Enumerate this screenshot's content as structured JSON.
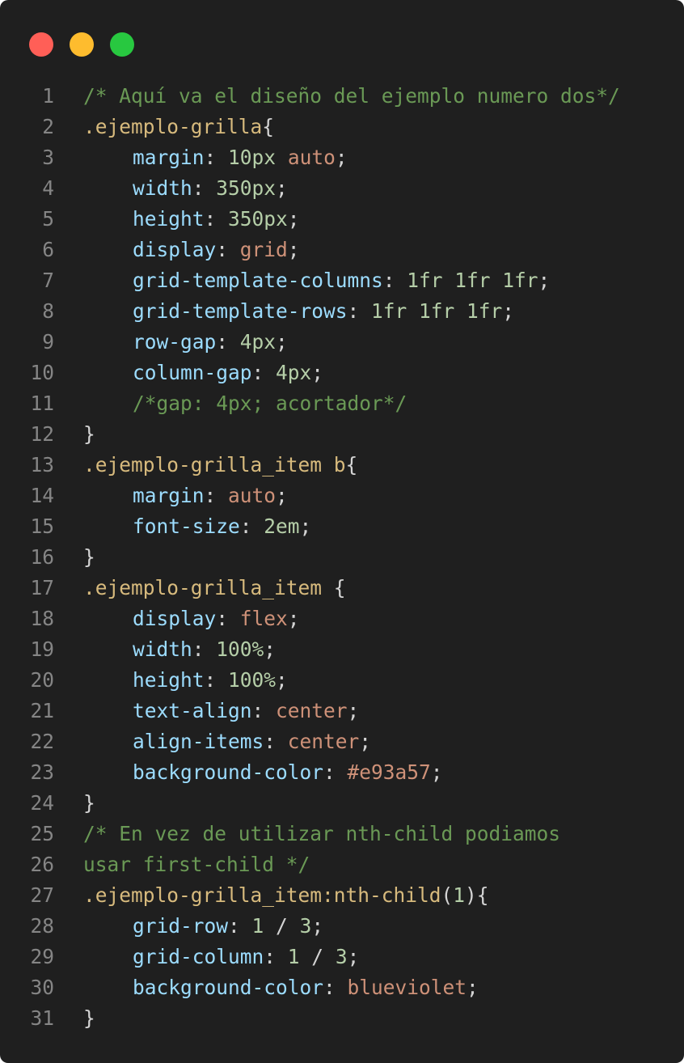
{
  "window": {
    "buttons": [
      "close",
      "minimize",
      "maximize"
    ],
    "colors": {
      "close": "#ff5f57",
      "minimize": "#febc2e",
      "maximize": "#28c840",
      "background": "#1f1f1f"
    }
  },
  "code": {
    "language": "css",
    "lines": [
      {
        "n": "1",
        "tokens": [
          {
            "t": "/* Aquí va el diseño del ejemplo numero dos*/",
            "c": "comment"
          }
        ]
      },
      {
        "n": "2",
        "tokens": [
          {
            "t": ".ejemplo-grilla",
            "c": "selector"
          },
          {
            "t": "{",
            "c": "punc"
          }
        ]
      },
      {
        "n": "3",
        "indent": 1,
        "tokens": [
          {
            "t": "margin",
            "c": "prop"
          },
          {
            "t": ": ",
            "c": "punc"
          },
          {
            "t": "10px",
            "c": "num"
          },
          {
            "t": " ",
            "c": "punc"
          },
          {
            "t": "auto",
            "c": "kw"
          },
          {
            "t": ";",
            "c": "punc"
          }
        ]
      },
      {
        "n": "4",
        "indent": 1,
        "tokens": [
          {
            "t": "width",
            "c": "prop"
          },
          {
            "t": ": ",
            "c": "punc"
          },
          {
            "t": "350px",
            "c": "num"
          },
          {
            "t": ";",
            "c": "punc"
          }
        ]
      },
      {
        "n": "5",
        "indent": 1,
        "tokens": [
          {
            "t": "height",
            "c": "prop"
          },
          {
            "t": ": ",
            "c": "punc"
          },
          {
            "t": "350px",
            "c": "num"
          },
          {
            "t": ";",
            "c": "punc"
          }
        ]
      },
      {
        "n": "6",
        "indent": 1,
        "tokens": [
          {
            "t": "display",
            "c": "prop"
          },
          {
            "t": ": ",
            "c": "punc"
          },
          {
            "t": "grid",
            "c": "kw"
          },
          {
            "t": ";",
            "c": "punc"
          }
        ]
      },
      {
        "n": "7",
        "indent": 1,
        "tokens": [
          {
            "t": "grid-template-columns",
            "c": "prop"
          },
          {
            "t": ": ",
            "c": "punc"
          },
          {
            "t": "1fr 1fr 1fr",
            "c": "num"
          },
          {
            "t": ";",
            "c": "punc"
          }
        ]
      },
      {
        "n": "8",
        "indent": 1,
        "tokens": [
          {
            "t": "grid-template-rows",
            "c": "prop"
          },
          {
            "t": ": ",
            "c": "punc"
          },
          {
            "t": "1fr 1fr 1fr",
            "c": "num"
          },
          {
            "t": ";",
            "c": "punc"
          }
        ]
      },
      {
        "n": "9",
        "indent": 1,
        "tokens": [
          {
            "t": "row-gap",
            "c": "prop"
          },
          {
            "t": ": ",
            "c": "punc"
          },
          {
            "t": "4px",
            "c": "num"
          },
          {
            "t": ";",
            "c": "punc"
          }
        ]
      },
      {
        "n": "10",
        "indent": 1,
        "tokens": [
          {
            "t": "column-gap",
            "c": "prop"
          },
          {
            "t": ": ",
            "c": "punc"
          },
          {
            "t": "4px",
            "c": "num"
          },
          {
            "t": ";",
            "c": "punc"
          }
        ]
      },
      {
        "n": "11",
        "indent": 1,
        "tokens": [
          {
            "t": "/*gap: 4px; acortador*/",
            "c": "comment"
          }
        ]
      },
      {
        "n": "12",
        "tokens": [
          {
            "t": "}",
            "c": "punc"
          }
        ]
      },
      {
        "n": "13",
        "tokens": [
          {
            "t": ".ejemplo-grilla_item b",
            "c": "selector"
          },
          {
            "t": "{",
            "c": "punc"
          }
        ]
      },
      {
        "n": "14",
        "indent": 1,
        "tokens": [
          {
            "t": "margin",
            "c": "prop"
          },
          {
            "t": ": ",
            "c": "punc"
          },
          {
            "t": "auto",
            "c": "kw"
          },
          {
            "t": ";",
            "c": "punc"
          }
        ]
      },
      {
        "n": "15",
        "indent": 1,
        "tokens": [
          {
            "t": "font-size",
            "c": "prop"
          },
          {
            "t": ": ",
            "c": "punc"
          },
          {
            "t": "2em",
            "c": "num"
          },
          {
            "t": ";",
            "c": "punc"
          }
        ]
      },
      {
        "n": "16",
        "tokens": [
          {
            "t": "}",
            "c": "punc"
          }
        ]
      },
      {
        "n": "17",
        "tokens": [
          {
            "t": ".ejemplo-grilla_item",
            "c": "selector"
          },
          {
            "t": " {",
            "c": "punc"
          }
        ]
      },
      {
        "n": "18",
        "indent": 1,
        "tokens": [
          {
            "t": "display",
            "c": "prop"
          },
          {
            "t": ": ",
            "c": "punc"
          },
          {
            "t": "flex",
            "c": "kw"
          },
          {
            "t": ";",
            "c": "punc"
          }
        ]
      },
      {
        "n": "19",
        "indent": 1,
        "tokens": [
          {
            "t": "width",
            "c": "prop"
          },
          {
            "t": ": ",
            "c": "punc"
          },
          {
            "t": "100%",
            "c": "num"
          },
          {
            "t": ";",
            "c": "punc"
          }
        ]
      },
      {
        "n": "20",
        "indent": 1,
        "tokens": [
          {
            "t": "height",
            "c": "prop"
          },
          {
            "t": ": ",
            "c": "punc"
          },
          {
            "t": "100%",
            "c": "num"
          },
          {
            "t": ";",
            "c": "punc"
          }
        ]
      },
      {
        "n": "21",
        "indent": 1,
        "tokens": [
          {
            "t": "text-align",
            "c": "prop"
          },
          {
            "t": ": ",
            "c": "punc"
          },
          {
            "t": "center",
            "c": "kw"
          },
          {
            "t": ";",
            "c": "punc"
          }
        ]
      },
      {
        "n": "22",
        "indent": 1,
        "tokens": [
          {
            "t": "align-items",
            "c": "prop"
          },
          {
            "t": ": ",
            "c": "punc"
          },
          {
            "t": "center",
            "c": "kw"
          },
          {
            "t": ";",
            "c": "punc"
          }
        ]
      },
      {
        "n": "23",
        "indent": 1,
        "tokens": [
          {
            "t": "background-color",
            "c": "prop"
          },
          {
            "t": ": ",
            "c": "punc"
          },
          {
            "t": "#e93a57",
            "c": "kw"
          },
          {
            "t": ";",
            "c": "punc"
          }
        ]
      },
      {
        "n": "24",
        "tokens": [
          {
            "t": "}",
            "c": "punc"
          }
        ]
      },
      {
        "n": "25",
        "tokens": [
          {
            "t": "/* En vez de utilizar nth-child podiamos",
            "c": "comment"
          }
        ]
      },
      {
        "n": "26",
        "tokens": [
          {
            "t": "usar first-child */",
            "c": "comment"
          }
        ]
      },
      {
        "n": "27",
        "tokens": [
          {
            "t": ".ejemplo-grilla_item:nth-child",
            "c": "selector"
          },
          {
            "t": "(",
            "c": "punc"
          },
          {
            "t": "1",
            "c": "num"
          },
          {
            "t": "){",
            "c": "punc"
          }
        ]
      },
      {
        "n": "28",
        "indent": 1,
        "tokens": [
          {
            "t": "grid-row",
            "c": "prop"
          },
          {
            "t": ": ",
            "c": "punc"
          },
          {
            "t": "1",
            "c": "num"
          },
          {
            "t": " / ",
            "c": "punc"
          },
          {
            "t": "3",
            "c": "num"
          },
          {
            "t": ";",
            "c": "punc"
          }
        ]
      },
      {
        "n": "29",
        "indent": 1,
        "tokens": [
          {
            "t": "grid-column",
            "c": "prop"
          },
          {
            "t": ": ",
            "c": "punc"
          },
          {
            "t": "1",
            "c": "num"
          },
          {
            "t": " / ",
            "c": "punc"
          },
          {
            "t": "3",
            "c": "num"
          },
          {
            "t": ";",
            "c": "punc"
          }
        ]
      },
      {
        "n": "30",
        "indent": 1,
        "tokens": [
          {
            "t": "background-color",
            "c": "prop"
          },
          {
            "t": ": ",
            "c": "punc"
          },
          {
            "t": "blueviolet",
            "c": "kw"
          },
          {
            "t": ";",
            "c": "punc"
          }
        ]
      },
      {
        "n": "31",
        "tokens": [
          {
            "t": "}",
            "c": "punc"
          }
        ]
      }
    ]
  }
}
